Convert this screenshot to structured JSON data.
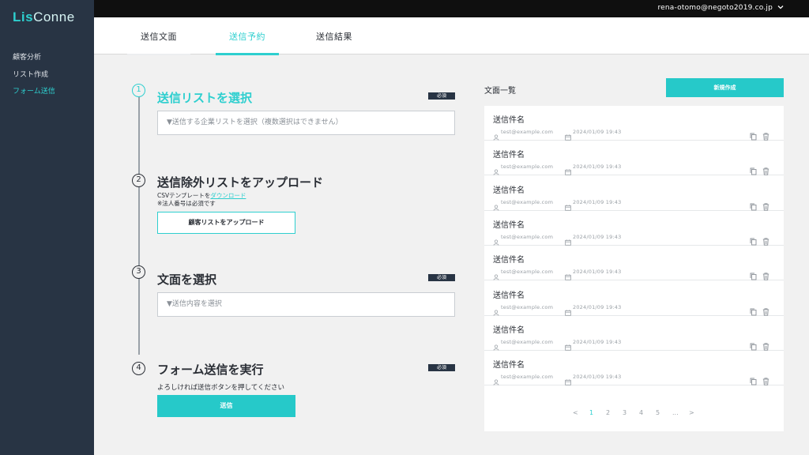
{
  "app": {
    "logo_part1": "Lis",
    "logo_part2": "Conne"
  },
  "sidebar": {
    "items": [
      {
        "label": "顧客分析",
        "active": false
      },
      {
        "label": "リスト作成",
        "active": false
      },
      {
        "label": "フォーム送信",
        "active": true
      }
    ]
  },
  "header": {
    "user_email": "rena-otomo@negoto2019.co.jp",
    "dropdown_icon": "chevron-down-icon"
  },
  "tabs": [
    {
      "label": "送信文面",
      "active": false
    },
    {
      "label": "送信予約",
      "active": true
    },
    {
      "label": "送信結果",
      "active": false
    }
  ],
  "steps": {
    "step1": {
      "number": "1",
      "title": "送信リストを選択",
      "badge": "必須",
      "select_placeholder": "▼送信する企業リストを選択（複数選択はできません）"
    },
    "step2": {
      "number": "2",
      "title": "送信除外リストをアップロード",
      "template_prefix": "CSVテンプレートを",
      "template_link": "ダウンロード",
      "note": "※法人番号は必須です",
      "upload_button": "顧客リストをアップロード"
    },
    "step3": {
      "number": "3",
      "title": "文面を選択",
      "badge": "必須",
      "select_placeholder": "▼送信内容を選択"
    },
    "step4": {
      "number": "4",
      "title": "フォーム送信を実行",
      "badge": "必須",
      "instruction": "よろしければ送信ボタンを押してください",
      "send_button": "送信"
    }
  },
  "document_list": {
    "heading": "文面一覧",
    "new_button": "新規作成",
    "items": [
      {
        "name": "送信件名",
        "email": "test@example.com",
        "date": "2024/01/09 19:43"
      },
      {
        "name": "送信件名",
        "email": "test@example.com",
        "date": "2024/01/09 19:43"
      },
      {
        "name": "送信件名",
        "email": "test@example.com",
        "date": "2024/01/09 19:43"
      },
      {
        "name": "送信件名",
        "email": "test@example.com",
        "date": "2024/01/09 19:43"
      },
      {
        "name": "送信件名",
        "email": "test@example.com",
        "date": "2024/01/09 19:43"
      },
      {
        "name": "送信件名",
        "email": "test@example.com",
        "date": "2024/01/09 19:43"
      },
      {
        "name": "送信件名",
        "email": "test@example.com",
        "date": "2024/01/09 19:43"
      },
      {
        "name": "送信件名",
        "email": "test@example.com",
        "date": "2024/01/09 19:43"
      }
    ],
    "icons": {
      "user": "user-icon",
      "calendar": "calendar-icon",
      "copy": "copy-icon",
      "delete": "trash-icon"
    }
  },
  "pagination": {
    "prev": "<",
    "pages": [
      "1",
      "2",
      "3",
      "4",
      "5"
    ],
    "current": "1",
    "ellipsis": "...",
    "next": ">"
  },
  "colors": {
    "accent": "#2ecfcf",
    "sidebar_bg": "#283444",
    "topbar_bg": "#0f0f0f",
    "badge_bg": "#283444"
  }
}
